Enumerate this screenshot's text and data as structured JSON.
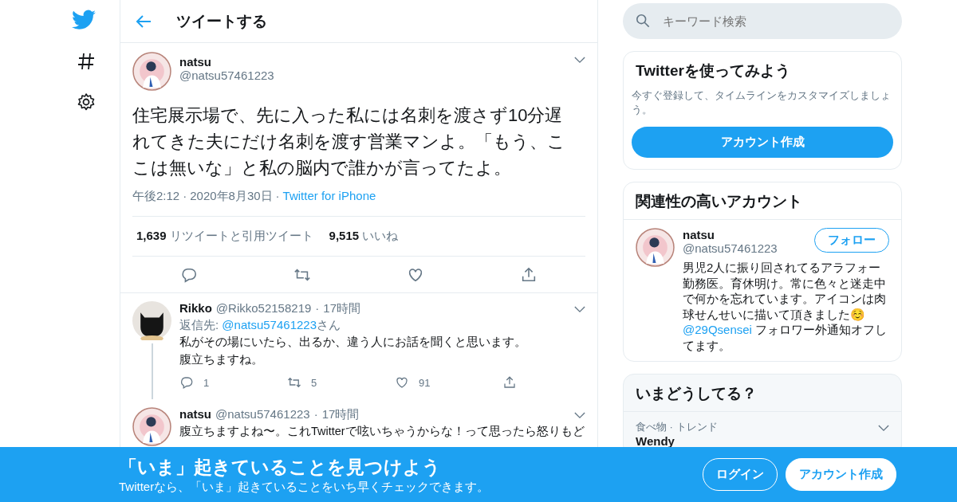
{
  "header": {
    "title": "ツイートする"
  },
  "tweet": {
    "name": "natsu",
    "handle": "@natsu57461223",
    "text": "住宅展示場で、先に入った私には名刺を渡さず10分遅れてきた夫にだけ名刺を渡す営業マンよ。「もう、ここは無いな」と私の脳内で誰かが言ってたよ。",
    "time": "午後2:12",
    "time_sep": "·",
    "date": "2020年8月30日",
    "date_sep": "·",
    "source": "Twitter for iPhone",
    "retweets": "1,639",
    "retweets_label": "リツイートと引用ツイート",
    "likes": "9,515",
    "likes_label": "いいね"
  },
  "replies": [
    {
      "name": "Rikko",
      "handle": "@Rikko52158219",
      "sep": "·",
      "time": "17時間",
      "kind": "cat",
      "reply_label": "返信先: ",
      "reply_to": "@natsu57461223",
      "reply_suffix": "さん",
      "lines": [
        "私がその場にいたら、出るか、違う人にお話を聞くと思います。",
        "腹立ちますね。"
      ],
      "replies": "1",
      "retweets": "5",
      "likes": "91",
      "threaded": true
    },
    {
      "name": "natsu",
      "handle": "@natsu57461223",
      "sep": "·",
      "time": "17時間",
      "kind": "person",
      "lines": [
        "腹立ちますよね〜。これTwitterで呟いちゃうからな！って思ったら怒りもど"
      ],
      "threaded": false
    }
  ],
  "search": {
    "placeholder": "キーワード検索"
  },
  "signup_card": {
    "title": "Twitterを使ってみよう",
    "description": "今すぐ登録して、タイムラインをカスタマイズしましょう。",
    "button": "アカウント作成"
  },
  "related": {
    "title": "関連性の高いアカウント",
    "name": "natsu",
    "handle": "@natsu57461223",
    "follow": "フォロー",
    "bio": "男児2人に振り回されてるアラフォー勤務医。育休明け。常に色々と迷走中で何かを忘れています。アイコンは肉球せんせいに描いて頂きました☺️",
    "bio_link": "@29Qsensei",
    "bio_end": " フォロワー外通知オフしてます。"
  },
  "trends": {
    "title": "いまどうしてる？",
    "category": "食べ物 · トレンド",
    "topic": "Wendy"
  },
  "banner": {
    "title": "「いま」起きていることを見つけよう",
    "subtitle": "Twitterなら、「いま」起きていることをいち早くチェックできます。",
    "login": "ログイン",
    "signup": "アカウント作成"
  }
}
